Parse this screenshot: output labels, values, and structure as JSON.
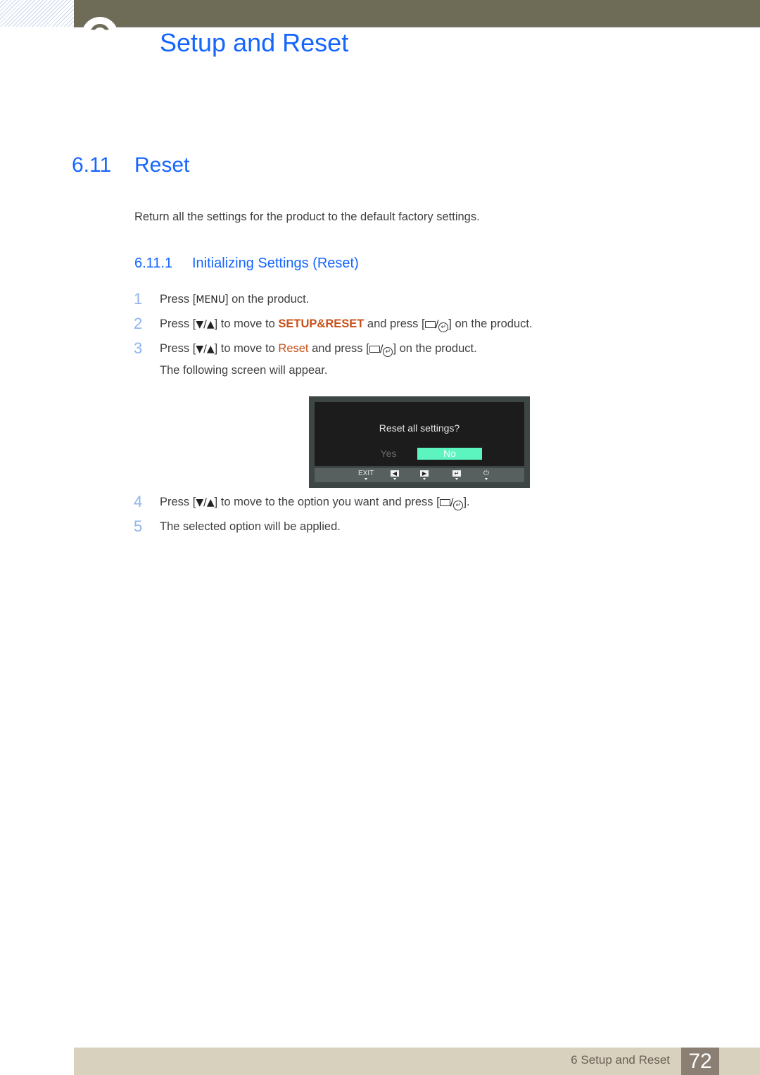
{
  "header": {
    "chapter_title": "Setup and Reset",
    "bar_color": "#6e6b57"
  },
  "section": {
    "number": "6.11",
    "title": "Reset",
    "intro": "Return all the settings for the product to the default factory settings."
  },
  "subsection": {
    "number": "6.11.1",
    "title": "Initializing Settings (Reset)"
  },
  "steps": [
    {
      "num": "1",
      "pre": "Press [",
      "key": "MENU",
      "post": "] on the product."
    },
    {
      "num": "2",
      "pre": "Press [",
      "key": "▼/▲",
      "mid": "] to move to ",
      "highlight": "SETUP&RESET",
      "mid2": " and press [",
      "post": "] on the product."
    },
    {
      "num": "3",
      "pre": "Press [",
      "key": "▼/▲",
      "mid": "] to move to ",
      "highlight": "Reset",
      "mid2": " and press [",
      "post": "] on the product."
    },
    {
      "num": "4",
      "pre": "Press [",
      "key": "▼/▲",
      "mid": "] to move to the option you want and press [",
      "post": "]."
    },
    {
      "num": "5",
      "text": "The selected option will be applied."
    }
  ],
  "step3_note": "The following screen will appear.",
  "osd": {
    "question": "Reset all settings?",
    "options": [
      "Yes",
      "No"
    ],
    "selected": "No",
    "selected_color": "#5cf5bf",
    "buttons": [
      {
        "label": "EXIT",
        "icon": "exit"
      },
      {
        "label": "◀",
        "icon": "left-arrow"
      },
      {
        "label": "▶",
        "icon": "right-arrow"
      },
      {
        "label": "↵",
        "icon": "enter"
      },
      {
        "label": "⏻",
        "icon": "power"
      }
    ]
  },
  "footer": {
    "label": "6 Setup and Reset",
    "page": "72"
  },
  "colors": {
    "heading": "#1565ff",
    "highlight": "#c8501a",
    "step_number": "#8fb4ee"
  }
}
